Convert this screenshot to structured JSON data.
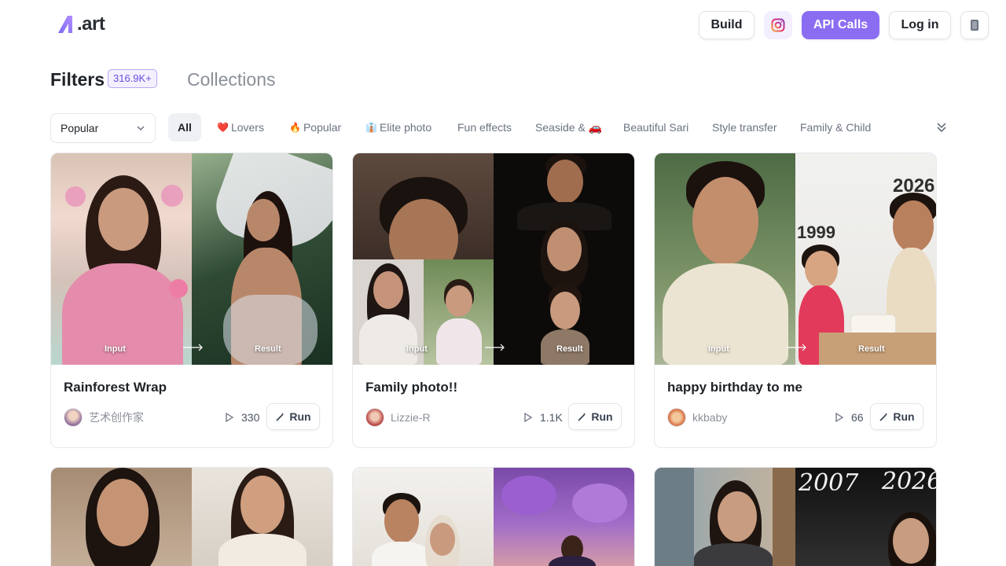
{
  "header": {
    "logo_text": ".art",
    "build_label": "Build",
    "api_calls_label": "API Calls",
    "login_label": "Log in",
    "accent_color": "#8b6df2"
  },
  "filters": {
    "title": "Filters",
    "count": "316.9K+",
    "collections": "Collections"
  },
  "sort": {
    "selected": "Popular"
  },
  "chips": [
    {
      "label": "All",
      "emoji": ""
    },
    {
      "label": "Lovers",
      "emoji": "❤️"
    },
    {
      "label": "Popular",
      "emoji": "🔥"
    },
    {
      "label": "Elite photo",
      "emoji": "👔"
    },
    {
      "label": "Fun effects",
      "emoji": ""
    },
    {
      "label": "Seaside & 🚗",
      "emoji": ""
    },
    {
      "label": "Beautiful Sari",
      "emoji": ""
    },
    {
      "label": "Style transfer",
      "emoji": ""
    },
    {
      "label": "Family & Child",
      "emoji": ""
    }
  ],
  "cards": [
    {
      "title": "Rainforest Wrap",
      "author": "艺术创作家",
      "runs": "330",
      "run_label": "Run",
      "input_label": "Input",
      "result_label": "Result"
    },
    {
      "title": "Family photo!!",
      "author": "Lizzie-R",
      "runs": "1.1K",
      "run_label": "Run",
      "input_label": "Input",
      "result_label": "Result"
    },
    {
      "title": "happy birthday to me",
      "author": "kkbaby",
      "runs": "66",
      "run_label": "Run",
      "input_label": "Input",
      "result_label": "Result",
      "year_left": "1999",
      "year_right": "2026"
    },
    {
      "title": "",
      "author": "",
      "runs": ""
    },
    {
      "title": "",
      "author": "",
      "runs": ""
    },
    {
      "title": "",
      "author": "",
      "runs": "",
      "year_left": "2007",
      "year_right": "2026"
    }
  ]
}
